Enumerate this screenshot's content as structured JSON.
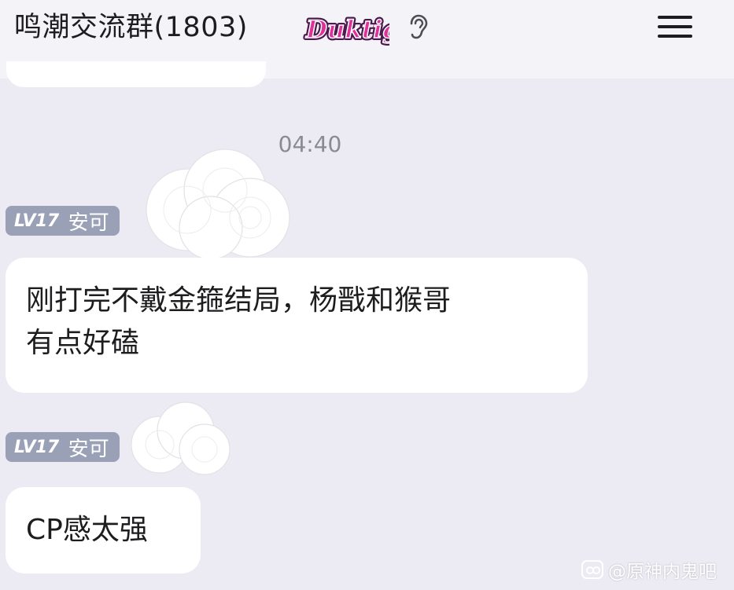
{
  "header": {
    "title": "鸣潮交流群(1803)",
    "brand_badge_text": "Duktig",
    "ear_icon": "ear-icon",
    "menu_icon": "hamburger-menu-icon"
  },
  "chat": {
    "timestamp": "04:40",
    "messages": [
      {
        "level": "LV17",
        "sender": "安可",
        "text_line1": "刚打完不戴金箍结局，杨戬和猴哥",
        "text_line2": "有点好磕"
      },
      {
        "level": "LV17",
        "sender": "安可",
        "text_line1": "CP感太强"
      }
    ]
  },
  "watermark": {
    "text": "@原神内鬼吧"
  },
  "colors": {
    "background": "#ecebf4",
    "header": "#f4f3f8",
    "bubble": "#ffffff",
    "level_badge": "#9aa1b7",
    "timestamp": "#8a8a92",
    "brand_badge_pink": "#e0309a"
  }
}
